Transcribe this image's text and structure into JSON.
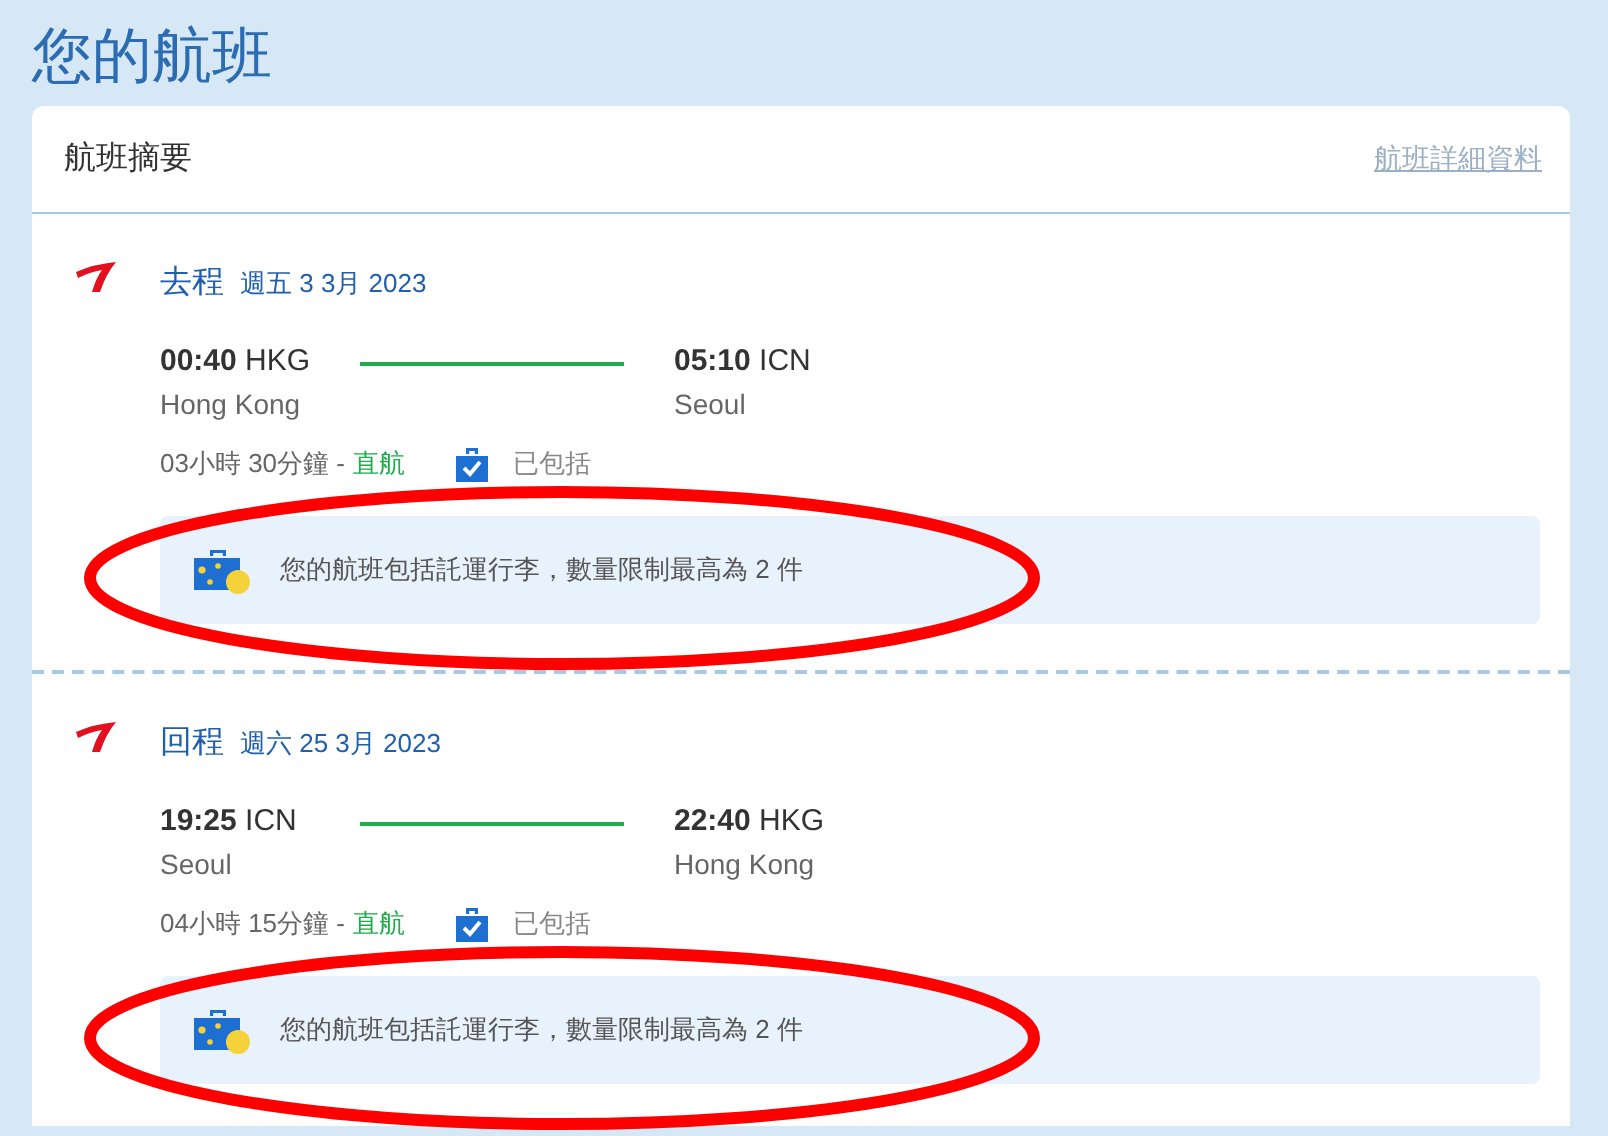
{
  "page_title": "您的航班",
  "summary": {
    "title": "航班摘要",
    "details_link": "航班詳細資料"
  },
  "legs": [
    {
      "label": "去程",
      "date": "週五 3 3月 2023",
      "departure": {
        "time": "00:40",
        "code": "HKG",
        "city": "Hong Kong"
      },
      "arrival": {
        "time": "05:10",
        "code": "ICN",
        "city": "Seoul"
      },
      "duration": "03小時 30分鐘 -",
      "stops": "直航",
      "baggage": "已包括",
      "notice": "您的航班包括託運行李，數量限制最高為 2 件",
      "highlighted": true
    },
    {
      "label": "回程",
      "date": "週六 25 3月 2023",
      "departure": {
        "time": "19:25",
        "code": "ICN",
        "city": "Seoul"
      },
      "arrival": {
        "time": "22:40",
        "code": "HKG",
        "city": "Hong Kong"
      },
      "duration": "04小時 15分鐘 -",
      "stops": "直航",
      "baggage": "已包括",
      "notice": "您的航班包括託運行李，數量限制最高為 2 件",
      "highlighted": true
    }
  ]
}
